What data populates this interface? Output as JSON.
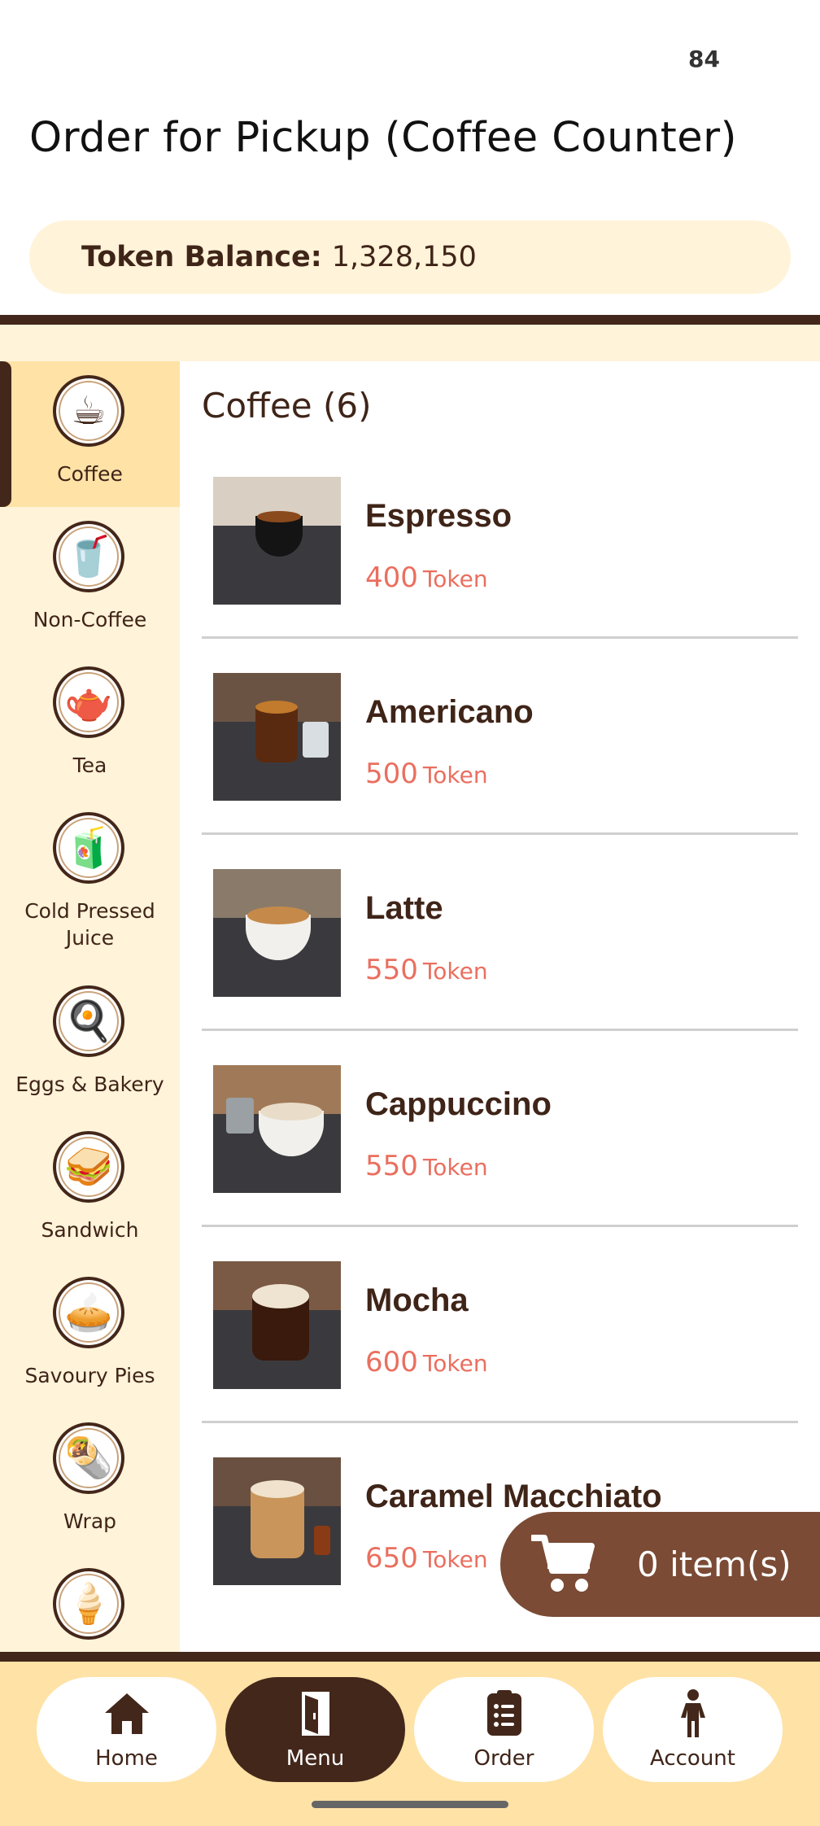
{
  "status": {
    "time": "84"
  },
  "header": {
    "title": "Order for Pickup (Coffee Counter)"
  },
  "balance": {
    "label": "Token Balance:",
    "value": "1,328,150"
  },
  "sidebar": {
    "items": [
      {
        "label": "Coffee",
        "icon": "coffee-cup-icon",
        "active": true
      },
      {
        "label": "Non-Coffee",
        "icon": "iced-drink-icon"
      },
      {
        "label": "Tea",
        "icon": "teapot-icon"
      },
      {
        "label": "Cold Pressed Juice",
        "icon": "juice-bottle-icon"
      },
      {
        "label": "Eggs & Bakery",
        "icon": "egg-croissant-icon"
      },
      {
        "label": "Sandwich",
        "icon": "sandwich-icon"
      },
      {
        "label": "Savoury Pies",
        "icon": "pie-icon"
      },
      {
        "label": "Wrap",
        "icon": "wrap-icon"
      },
      {
        "label": "",
        "icon": "ice-cream-icon"
      }
    ]
  },
  "main": {
    "section_title": "Coffee (6)",
    "items": [
      {
        "name": "Espresso",
        "price": "400",
        "unit": "Token",
        "image": "espresso-image"
      },
      {
        "name": "Americano",
        "price": "500",
        "unit": "Token",
        "image": "americano-image"
      },
      {
        "name": "Latte",
        "price": "550",
        "unit": "Token",
        "image": "latte-image"
      },
      {
        "name": "Cappuccino",
        "price": "550",
        "unit": "Token",
        "image": "cappuccino-image"
      },
      {
        "name": "Mocha",
        "price": "600",
        "unit": "Token",
        "image": "mocha-image"
      },
      {
        "name": "Caramel Macchiato",
        "price": "650",
        "unit": "Token",
        "image": "caramel-macchiato-image"
      }
    ]
  },
  "cart": {
    "label": "0 item(s)",
    "icon": "shopping-cart-icon"
  },
  "nav": {
    "items": [
      {
        "label": "Home",
        "icon": "home-icon"
      },
      {
        "label": "Menu",
        "icon": "menu-book-icon",
        "active": true
      },
      {
        "label": "Order",
        "icon": "order-clipboard-icon"
      },
      {
        "label": "Account",
        "icon": "person-icon"
      }
    ]
  },
  "colors": {
    "brand_dark": "#43271a",
    "cream": "#fff3d9",
    "active_yellow": "#ffe2a6",
    "price": "#ea6f5f",
    "cart": "#7b4b35"
  }
}
